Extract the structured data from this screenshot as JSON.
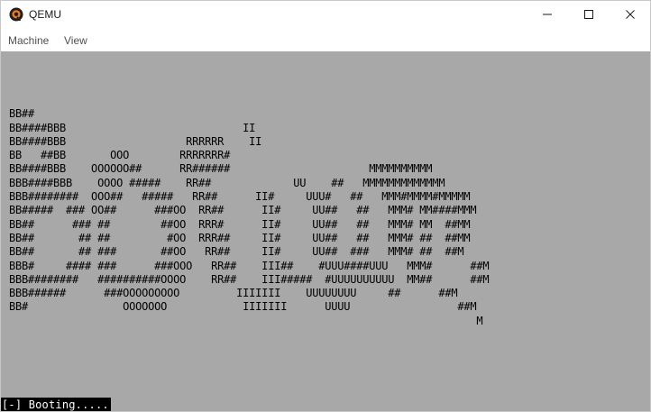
{
  "window": {
    "title": "QEMU",
    "app_icon": "qemu-logo-icon",
    "controls": {
      "minimize_icon": "minimize-icon",
      "maximize_icon": "maximize-icon",
      "close_icon": "close-icon"
    }
  },
  "menu": {
    "items": [
      {
        "label": "Machine"
      },
      {
        "label": "View"
      }
    ]
  },
  "screen": {
    "background": "#a8a8a8",
    "text_color": "#000000",
    "ascii_lines": [
      "",
      "BB##",
      "BB####BBB                            II",
      "BB####BBB                   RRRRRR    II",
      "BB   ##BB       OOO        RRRRRRR#",
      "BB####BBB    OOOOOO##      RR######                      MMMMMMMMMM",
      "BBB####BBB    OOOO #####    RR##             UU    ##   MMMMMMMMMMMMM",
      "BBB########  OOO##   #####   RR##      II#     UUU#   ##   MMM#MMMM#MMMMM",
      "BB#####  ### OO##      ###OO  RR##      II#     UU##   ##   MMM# MM####MMM",
      "BB##      ### ##        ##OO  RRR#      II#     UU##   ##   MMM# MM  ##MM",
      "BB##       ## ##         #OO  RRR##     II#     UU##   ##   MMM# ##  ##MM",
      "BB##       ## ###       ##OO   RR##     II#     UU##  ###   MMM# ##  ##M",
      "BBB#     #### ###      ###OOO   RR##    III##    #UUU####UUU   MMM#      ##M",
      "BBB########   ##########OOOO    RR##    III#####  #UUUUUUUUUU  MM##      ##M",
      "BBB######      ###OOOOOOOOO         IIIIIII    UUUUUUUU     ##      ##M",
      "BB#               OOOOOOO            IIIIIII      UUUU                 ##M",
      "                                                                          M"
    ],
    "status_text": "[-] Booting....."
  }
}
